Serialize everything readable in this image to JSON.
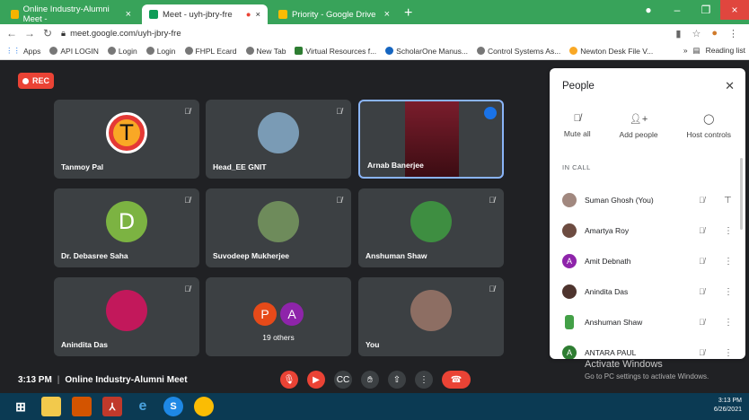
{
  "tabs": [
    {
      "label": "Online Industry-Alumni Meet - ",
      "icon": "meet-logo",
      "color": "#f4b400"
    },
    {
      "label": "Meet - uyh-jbry-fre",
      "icon": "meet-logo",
      "color": "#0f9d58"
    },
    {
      "label": "Priority - Google Drive",
      "icon": "drive-logo",
      "color": "#fbbc04"
    }
  ],
  "address": {
    "url": "meet.google.com/uyh-jbry-fre"
  },
  "bookmarks": [
    "Apps",
    "API LOGIN",
    "Login",
    "Login",
    "FHPL Ecard",
    "New Tab",
    "Virtual Resources f...",
    "ScholarOne Manus...",
    "Control Systems As...",
    "Newton Desk File V..."
  ],
  "bookmarks_right": "Reading list",
  "rec_label": "REC",
  "tiles": [
    {
      "name": "Tanmoy Pal",
      "avatar_letter": "T",
      "avatar_color": "#e53935"
    },
    {
      "name": "Head_EE GNIT",
      "avatar_letter": "",
      "avatar_color": "#7a9bb5"
    },
    {
      "name": "Arnab Banerjee",
      "avatar_letter": "",
      "avatar_color": "#5a1c23"
    },
    {
      "name": "Dr. Debasree Saha",
      "avatar_letter": "D",
      "avatar_color": "#7cb342"
    },
    {
      "name": "Suvodeep Mukherjee",
      "avatar_letter": "",
      "avatar_color": "#6e8b5b"
    },
    {
      "name": "Anshuman Shaw",
      "avatar_letter": "",
      "avatar_color": "#3e8e41"
    },
    {
      "name": "Anindita Das",
      "avatar_letter": "",
      "avatar_color": "#c2185b"
    },
    {
      "name": "19 others",
      "avatar_letter": "",
      "avatar_color": ""
    },
    {
      "name": "You",
      "avatar_letter": "",
      "avatar_color": "#8d6e63"
    }
  ],
  "others": {
    "letters": [
      "P",
      "A"
    ],
    "colors": [
      "#e64a19",
      "#8e24aa"
    ]
  },
  "meet": {
    "time": "3:13 PM",
    "title": "Online Industry-Alumni Meet"
  },
  "panel": {
    "title": "People",
    "actions": [
      {
        "label": "Mute all",
        "icon": "mic-off-icon"
      },
      {
        "label": "Add people",
        "icon": "person-add-icon"
      },
      {
        "label": "Host controls",
        "icon": "toggle-icon"
      }
    ],
    "section": "IN CALL",
    "people": [
      {
        "name": "Suman Ghosh (You)",
        "letter": "",
        "color": "#a1887f"
      },
      {
        "name": "Amartya Roy",
        "letter": "",
        "color": "#6d4c41"
      },
      {
        "name": "Amit Debnath",
        "letter": "A",
        "color": "#8e24aa"
      },
      {
        "name": "Anindita Das",
        "letter": "",
        "color": "#4e342e"
      },
      {
        "name": "Anshuman Shaw",
        "letter": "",
        "color": "#43a047"
      },
      {
        "name": "ANTARA PAUL",
        "letter": "A",
        "color": "#2e7d32"
      }
    ]
  },
  "activate": {
    "title": "Activate Windows",
    "sub": "Go to PC settings to activate Windows."
  },
  "clock": {
    "time": "3:13 PM",
    "date": "6/26/2021"
  }
}
